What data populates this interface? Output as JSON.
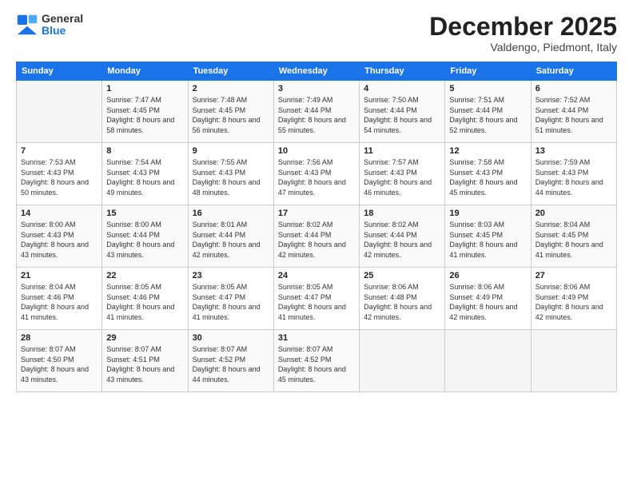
{
  "header": {
    "logo": {
      "general": "General",
      "blue": "Blue"
    },
    "title": "December 2025",
    "location": "Valdengo, Piedmont, Italy"
  },
  "calendar": {
    "weekdays": [
      "Sunday",
      "Monday",
      "Tuesday",
      "Wednesday",
      "Thursday",
      "Friday",
      "Saturday"
    ],
    "weeks": [
      [
        {
          "day": "",
          "sunrise": "",
          "sunset": "",
          "daylight": ""
        },
        {
          "day": "1",
          "sunrise": "Sunrise: 7:47 AM",
          "sunset": "Sunset: 4:45 PM",
          "daylight": "Daylight: 8 hours and 58 minutes."
        },
        {
          "day": "2",
          "sunrise": "Sunrise: 7:48 AM",
          "sunset": "Sunset: 4:45 PM",
          "daylight": "Daylight: 8 hours and 56 minutes."
        },
        {
          "day": "3",
          "sunrise": "Sunrise: 7:49 AM",
          "sunset": "Sunset: 4:44 PM",
          "daylight": "Daylight: 8 hours and 55 minutes."
        },
        {
          "day": "4",
          "sunrise": "Sunrise: 7:50 AM",
          "sunset": "Sunset: 4:44 PM",
          "daylight": "Daylight: 8 hours and 54 minutes."
        },
        {
          "day": "5",
          "sunrise": "Sunrise: 7:51 AM",
          "sunset": "Sunset: 4:44 PM",
          "daylight": "Daylight: 8 hours and 52 minutes."
        },
        {
          "day": "6",
          "sunrise": "Sunrise: 7:52 AM",
          "sunset": "Sunset: 4:44 PM",
          "daylight": "Daylight: 8 hours and 51 minutes."
        }
      ],
      [
        {
          "day": "7",
          "sunrise": "Sunrise: 7:53 AM",
          "sunset": "Sunset: 4:43 PM",
          "daylight": "Daylight: 8 hours and 50 minutes."
        },
        {
          "day": "8",
          "sunrise": "Sunrise: 7:54 AM",
          "sunset": "Sunset: 4:43 PM",
          "daylight": "Daylight: 8 hours and 49 minutes."
        },
        {
          "day": "9",
          "sunrise": "Sunrise: 7:55 AM",
          "sunset": "Sunset: 4:43 PM",
          "daylight": "Daylight: 8 hours and 48 minutes."
        },
        {
          "day": "10",
          "sunrise": "Sunrise: 7:56 AM",
          "sunset": "Sunset: 4:43 PM",
          "daylight": "Daylight: 8 hours and 47 minutes."
        },
        {
          "day": "11",
          "sunrise": "Sunrise: 7:57 AM",
          "sunset": "Sunset: 4:43 PM",
          "daylight": "Daylight: 8 hours and 46 minutes."
        },
        {
          "day": "12",
          "sunrise": "Sunrise: 7:58 AM",
          "sunset": "Sunset: 4:43 PM",
          "daylight": "Daylight: 8 hours and 45 minutes."
        },
        {
          "day": "13",
          "sunrise": "Sunrise: 7:59 AM",
          "sunset": "Sunset: 4:43 PM",
          "daylight": "Daylight: 8 hours and 44 minutes."
        }
      ],
      [
        {
          "day": "14",
          "sunrise": "Sunrise: 8:00 AM",
          "sunset": "Sunset: 4:43 PM",
          "daylight": "Daylight: 8 hours and 43 minutes."
        },
        {
          "day": "15",
          "sunrise": "Sunrise: 8:00 AM",
          "sunset": "Sunset: 4:44 PM",
          "daylight": "Daylight: 8 hours and 43 minutes."
        },
        {
          "day": "16",
          "sunrise": "Sunrise: 8:01 AM",
          "sunset": "Sunset: 4:44 PM",
          "daylight": "Daylight: 8 hours and 42 minutes."
        },
        {
          "day": "17",
          "sunrise": "Sunrise: 8:02 AM",
          "sunset": "Sunset: 4:44 PM",
          "daylight": "Daylight: 8 hours and 42 minutes."
        },
        {
          "day": "18",
          "sunrise": "Sunrise: 8:02 AM",
          "sunset": "Sunset: 4:44 PM",
          "daylight": "Daylight: 8 hours and 42 minutes."
        },
        {
          "day": "19",
          "sunrise": "Sunrise: 8:03 AM",
          "sunset": "Sunset: 4:45 PM",
          "daylight": "Daylight: 8 hours and 41 minutes."
        },
        {
          "day": "20",
          "sunrise": "Sunrise: 8:04 AM",
          "sunset": "Sunset: 4:45 PM",
          "daylight": "Daylight: 8 hours and 41 minutes."
        }
      ],
      [
        {
          "day": "21",
          "sunrise": "Sunrise: 8:04 AM",
          "sunset": "Sunset: 4:46 PM",
          "daylight": "Daylight: 8 hours and 41 minutes."
        },
        {
          "day": "22",
          "sunrise": "Sunrise: 8:05 AM",
          "sunset": "Sunset: 4:46 PM",
          "daylight": "Daylight: 8 hours and 41 minutes."
        },
        {
          "day": "23",
          "sunrise": "Sunrise: 8:05 AM",
          "sunset": "Sunset: 4:47 PM",
          "daylight": "Daylight: 8 hours and 41 minutes."
        },
        {
          "day": "24",
          "sunrise": "Sunrise: 8:05 AM",
          "sunset": "Sunset: 4:47 PM",
          "daylight": "Daylight: 8 hours and 41 minutes."
        },
        {
          "day": "25",
          "sunrise": "Sunrise: 8:06 AM",
          "sunset": "Sunset: 4:48 PM",
          "daylight": "Daylight: 8 hours and 42 minutes."
        },
        {
          "day": "26",
          "sunrise": "Sunrise: 8:06 AM",
          "sunset": "Sunset: 4:49 PM",
          "daylight": "Daylight: 8 hours and 42 minutes."
        },
        {
          "day": "27",
          "sunrise": "Sunrise: 8:06 AM",
          "sunset": "Sunset: 4:49 PM",
          "daylight": "Daylight: 8 hours and 42 minutes."
        }
      ],
      [
        {
          "day": "28",
          "sunrise": "Sunrise: 8:07 AM",
          "sunset": "Sunset: 4:50 PM",
          "daylight": "Daylight: 8 hours and 43 minutes."
        },
        {
          "day": "29",
          "sunrise": "Sunrise: 8:07 AM",
          "sunset": "Sunset: 4:51 PM",
          "daylight": "Daylight: 8 hours and 43 minutes."
        },
        {
          "day": "30",
          "sunrise": "Sunrise: 8:07 AM",
          "sunset": "Sunset: 4:52 PM",
          "daylight": "Daylight: 8 hours and 44 minutes."
        },
        {
          "day": "31",
          "sunrise": "Sunrise: 8:07 AM",
          "sunset": "Sunset: 4:52 PM",
          "daylight": "Daylight: 8 hours and 45 minutes."
        },
        {
          "day": "",
          "sunrise": "",
          "sunset": "",
          "daylight": ""
        },
        {
          "day": "",
          "sunrise": "",
          "sunset": "",
          "daylight": ""
        },
        {
          "day": "",
          "sunrise": "",
          "sunset": "",
          "daylight": ""
        }
      ]
    ]
  }
}
